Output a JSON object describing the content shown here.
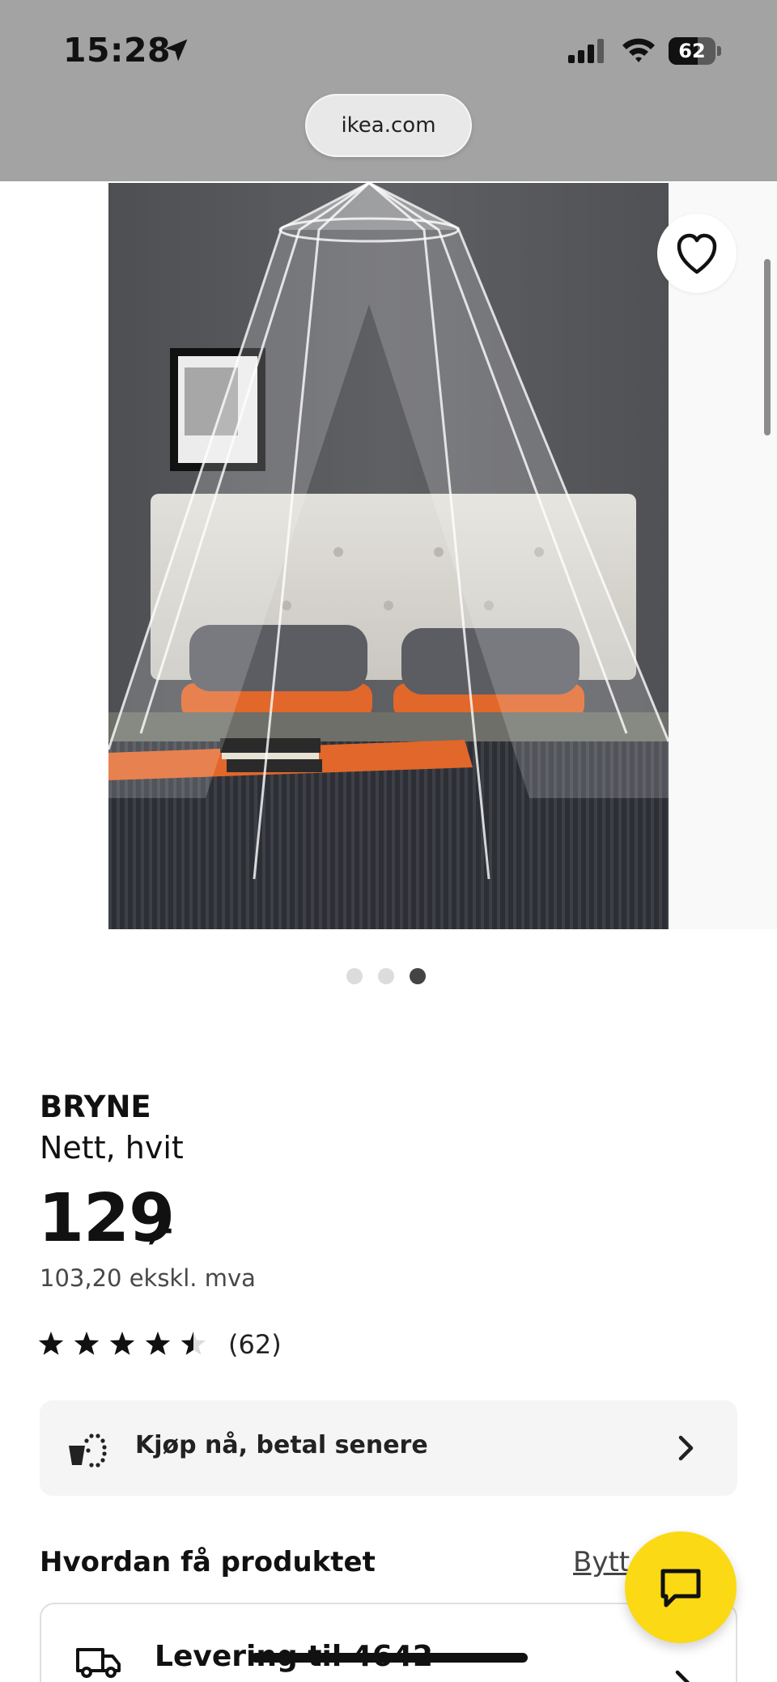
{
  "status_bar": {
    "time": "15:28",
    "battery_level": "62",
    "battery_fraction": 0.62
  },
  "browser": {
    "url": "ikea.com"
  },
  "gallery": {
    "slide_count": 3,
    "active_slide": 3,
    "favorite_icon": "heart-outline-icon"
  },
  "product": {
    "name": "BRYNE",
    "description": "Nett, hvit",
    "price": "129",
    "price_suffix": ",-",
    "price_ex_vat": "103,20 ekskl. mva",
    "rating_value": 4.5,
    "rating_max": 5,
    "rating_count": "(62)"
  },
  "pay_later": {
    "label": "Kjøp nå, betal senere",
    "icon": "payment-split-icon"
  },
  "delivery_section": {
    "title": "Hvordan få produktet",
    "change_link": "Bytt",
    "delivery_label": "Levering til 4642",
    "icon": "truck-icon"
  },
  "chat": {
    "icon": "chat-bubble-icon",
    "color": "#fbd914"
  },
  "colors": {
    "accent_yellow": "#fbd914",
    "text_primary": "#111111",
    "card_bg": "#f5f5f5"
  }
}
